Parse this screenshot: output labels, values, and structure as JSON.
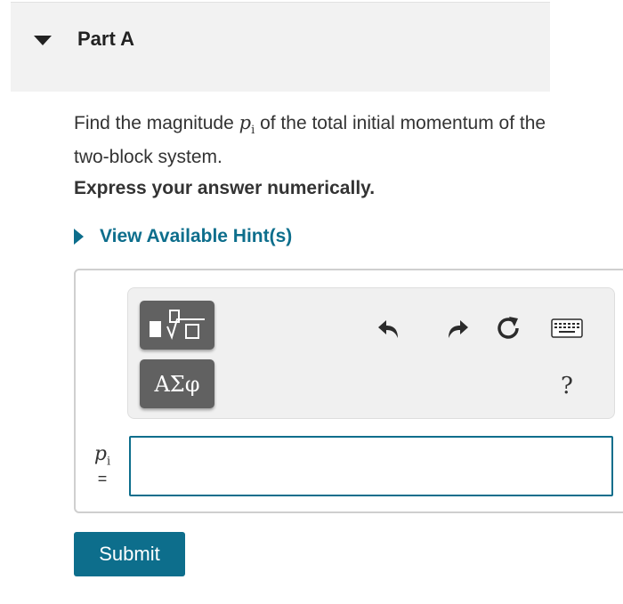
{
  "part": {
    "title": "Part A"
  },
  "question": {
    "text_before": "Find the magnitude ",
    "var_base": "p",
    "var_sub": "i",
    "text_after": " of the total initial momentum of the two-block system."
  },
  "instruction": "Express your answer numerically.",
  "hint": {
    "label": "View Available Hint(s)"
  },
  "toolbar": {
    "greek_label": "ΑΣφ",
    "help_label": "?",
    "icons": [
      "templates-icon",
      "greek-symbols-icon",
      "undo-icon",
      "redo-icon",
      "reset-icon",
      "keyboard-icon",
      "help-icon"
    ]
  },
  "answer": {
    "var_base": "p",
    "var_sub": "i",
    "equals": "=",
    "value": "",
    "placeholder": ""
  },
  "submit": {
    "label": "Submit"
  },
  "colors": {
    "accent": "#0d6e8c",
    "tool_button": "#616161",
    "header_bg": "#f2f2f2"
  }
}
